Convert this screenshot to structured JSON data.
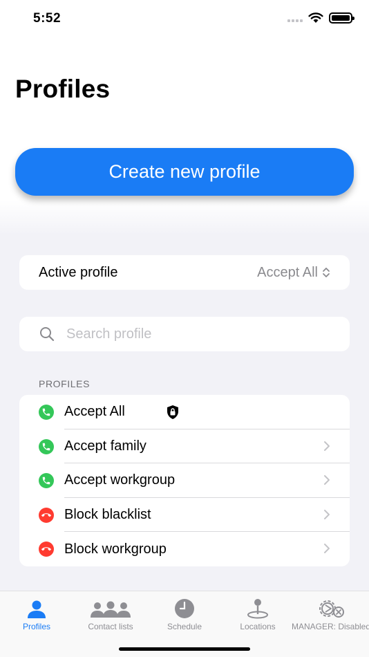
{
  "status_bar": {
    "time": "5:52"
  },
  "header": {
    "title": "Profiles"
  },
  "create_button": {
    "label": "Create new profile"
  },
  "active_profile": {
    "label": "Active profile",
    "value": "Accept All"
  },
  "search": {
    "placeholder": "Search profile",
    "value": ""
  },
  "profiles_section": {
    "header": "PROFILES",
    "items": [
      {
        "label": "Accept All",
        "status": "accept",
        "locked": true
      },
      {
        "label": "Accept family",
        "status": "accept",
        "locked": false
      },
      {
        "label": "Accept workgroup",
        "status": "accept",
        "locked": false
      },
      {
        "label": "Block blacklist",
        "status": "block",
        "locked": false
      },
      {
        "label": "Block workgroup",
        "status": "block",
        "locked": false
      }
    ]
  },
  "tab_bar": {
    "tabs": [
      {
        "label": "Profiles",
        "icon": "person-icon",
        "active": true
      },
      {
        "label": "Contact lists",
        "icon": "people-group-icon",
        "active": false
      },
      {
        "label": "Schedule",
        "icon": "clock-icon",
        "active": false
      },
      {
        "label": "Locations",
        "icon": "location-pin-icon",
        "active": false
      },
      {
        "label": "MANAGER: Disabled",
        "icon": "gear-disabled-icon",
        "active": false
      }
    ]
  },
  "colors": {
    "accent": "#1a7cf5",
    "accept": "#34c759",
    "block": "#ff3b30",
    "background": "#f2f2f7"
  }
}
